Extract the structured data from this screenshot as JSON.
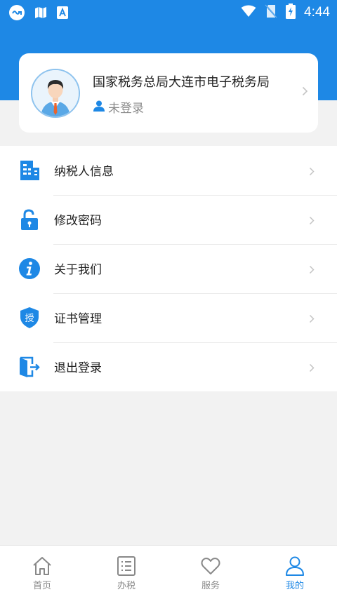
{
  "status_bar": {
    "time": "4:44",
    "left_icons": [
      "app-notification-icon",
      "map-notification-icon",
      "store-notification-icon"
    ],
    "right_icons": [
      "wifi-icon",
      "no-sim-icon",
      "battery-charging-icon"
    ]
  },
  "profile": {
    "org_name": "国家税务总局大连市电子税务局",
    "login_status": "未登录"
  },
  "menu": {
    "items": [
      {
        "label": "纳税人信息",
        "icon": "building-icon"
      },
      {
        "label": "修改密码",
        "icon": "lock-icon"
      },
      {
        "label": "关于我们",
        "icon": "info-icon"
      },
      {
        "label": "证书管理",
        "icon": "certificate-shield-icon"
      },
      {
        "label": "退出登录",
        "icon": "logout-door-icon"
      }
    ],
    "cert_badge_char": "授"
  },
  "bottom_nav": {
    "items": [
      {
        "label": "首页",
        "icon": "home-icon",
        "active": false
      },
      {
        "label": "办税",
        "icon": "list-icon",
        "active": false
      },
      {
        "label": "服务",
        "icon": "heart-icon",
        "active": false
      },
      {
        "label": "我的",
        "icon": "user-icon",
        "active": true
      }
    ]
  },
  "colors": {
    "primary": "#1e88e5",
    "background": "#f2f2f2",
    "inactive": "#888888"
  }
}
